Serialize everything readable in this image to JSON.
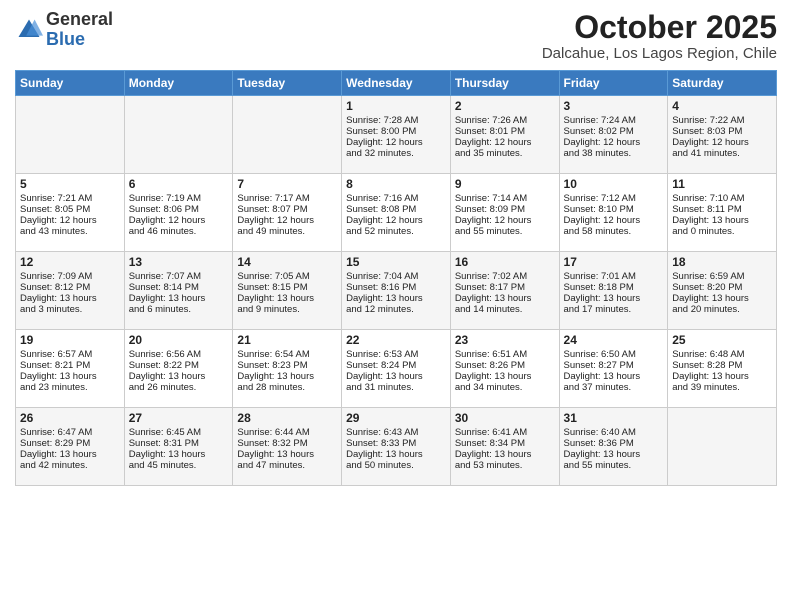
{
  "logo": {
    "general": "General",
    "blue": "Blue"
  },
  "title": "October 2025",
  "subtitle": "Dalcahue, Los Lagos Region, Chile",
  "headers": [
    "Sunday",
    "Monday",
    "Tuesday",
    "Wednesday",
    "Thursday",
    "Friday",
    "Saturday"
  ],
  "rows": [
    [
      {
        "day": "",
        "lines": []
      },
      {
        "day": "",
        "lines": []
      },
      {
        "day": "",
        "lines": []
      },
      {
        "day": "1",
        "lines": [
          "Sunrise: 7:28 AM",
          "Sunset: 8:00 PM",
          "Daylight: 12 hours",
          "and 32 minutes."
        ]
      },
      {
        "day": "2",
        "lines": [
          "Sunrise: 7:26 AM",
          "Sunset: 8:01 PM",
          "Daylight: 12 hours",
          "and 35 minutes."
        ]
      },
      {
        "day": "3",
        "lines": [
          "Sunrise: 7:24 AM",
          "Sunset: 8:02 PM",
          "Daylight: 12 hours",
          "and 38 minutes."
        ]
      },
      {
        "day": "4",
        "lines": [
          "Sunrise: 7:22 AM",
          "Sunset: 8:03 PM",
          "Daylight: 12 hours",
          "and 41 minutes."
        ]
      }
    ],
    [
      {
        "day": "5",
        "lines": [
          "Sunrise: 7:21 AM",
          "Sunset: 8:05 PM",
          "Daylight: 12 hours",
          "and 43 minutes."
        ]
      },
      {
        "day": "6",
        "lines": [
          "Sunrise: 7:19 AM",
          "Sunset: 8:06 PM",
          "Daylight: 12 hours",
          "and 46 minutes."
        ]
      },
      {
        "day": "7",
        "lines": [
          "Sunrise: 7:17 AM",
          "Sunset: 8:07 PM",
          "Daylight: 12 hours",
          "and 49 minutes."
        ]
      },
      {
        "day": "8",
        "lines": [
          "Sunrise: 7:16 AM",
          "Sunset: 8:08 PM",
          "Daylight: 12 hours",
          "and 52 minutes."
        ]
      },
      {
        "day": "9",
        "lines": [
          "Sunrise: 7:14 AM",
          "Sunset: 8:09 PM",
          "Daylight: 12 hours",
          "and 55 minutes."
        ]
      },
      {
        "day": "10",
        "lines": [
          "Sunrise: 7:12 AM",
          "Sunset: 8:10 PM",
          "Daylight: 12 hours",
          "and 58 minutes."
        ]
      },
      {
        "day": "11",
        "lines": [
          "Sunrise: 7:10 AM",
          "Sunset: 8:11 PM",
          "Daylight: 13 hours",
          "and 0 minutes."
        ]
      }
    ],
    [
      {
        "day": "12",
        "lines": [
          "Sunrise: 7:09 AM",
          "Sunset: 8:12 PM",
          "Daylight: 13 hours",
          "and 3 minutes."
        ]
      },
      {
        "day": "13",
        "lines": [
          "Sunrise: 7:07 AM",
          "Sunset: 8:14 PM",
          "Daylight: 13 hours",
          "and 6 minutes."
        ]
      },
      {
        "day": "14",
        "lines": [
          "Sunrise: 7:05 AM",
          "Sunset: 8:15 PM",
          "Daylight: 13 hours",
          "and 9 minutes."
        ]
      },
      {
        "day": "15",
        "lines": [
          "Sunrise: 7:04 AM",
          "Sunset: 8:16 PM",
          "Daylight: 13 hours",
          "and 12 minutes."
        ]
      },
      {
        "day": "16",
        "lines": [
          "Sunrise: 7:02 AM",
          "Sunset: 8:17 PM",
          "Daylight: 13 hours",
          "and 14 minutes."
        ]
      },
      {
        "day": "17",
        "lines": [
          "Sunrise: 7:01 AM",
          "Sunset: 8:18 PM",
          "Daylight: 13 hours",
          "and 17 minutes."
        ]
      },
      {
        "day": "18",
        "lines": [
          "Sunrise: 6:59 AM",
          "Sunset: 8:20 PM",
          "Daylight: 13 hours",
          "and 20 minutes."
        ]
      }
    ],
    [
      {
        "day": "19",
        "lines": [
          "Sunrise: 6:57 AM",
          "Sunset: 8:21 PM",
          "Daylight: 13 hours",
          "and 23 minutes."
        ]
      },
      {
        "day": "20",
        "lines": [
          "Sunrise: 6:56 AM",
          "Sunset: 8:22 PM",
          "Daylight: 13 hours",
          "and 26 minutes."
        ]
      },
      {
        "day": "21",
        "lines": [
          "Sunrise: 6:54 AM",
          "Sunset: 8:23 PM",
          "Daylight: 13 hours",
          "and 28 minutes."
        ]
      },
      {
        "day": "22",
        "lines": [
          "Sunrise: 6:53 AM",
          "Sunset: 8:24 PM",
          "Daylight: 13 hours",
          "and 31 minutes."
        ]
      },
      {
        "day": "23",
        "lines": [
          "Sunrise: 6:51 AM",
          "Sunset: 8:26 PM",
          "Daylight: 13 hours",
          "and 34 minutes."
        ]
      },
      {
        "day": "24",
        "lines": [
          "Sunrise: 6:50 AM",
          "Sunset: 8:27 PM",
          "Daylight: 13 hours",
          "and 37 minutes."
        ]
      },
      {
        "day": "25",
        "lines": [
          "Sunrise: 6:48 AM",
          "Sunset: 8:28 PM",
          "Daylight: 13 hours",
          "and 39 minutes."
        ]
      }
    ],
    [
      {
        "day": "26",
        "lines": [
          "Sunrise: 6:47 AM",
          "Sunset: 8:29 PM",
          "Daylight: 13 hours",
          "and 42 minutes."
        ]
      },
      {
        "day": "27",
        "lines": [
          "Sunrise: 6:45 AM",
          "Sunset: 8:31 PM",
          "Daylight: 13 hours",
          "and 45 minutes."
        ]
      },
      {
        "day": "28",
        "lines": [
          "Sunrise: 6:44 AM",
          "Sunset: 8:32 PM",
          "Daylight: 13 hours",
          "and 47 minutes."
        ]
      },
      {
        "day": "29",
        "lines": [
          "Sunrise: 6:43 AM",
          "Sunset: 8:33 PM",
          "Daylight: 13 hours",
          "and 50 minutes."
        ]
      },
      {
        "day": "30",
        "lines": [
          "Sunrise: 6:41 AM",
          "Sunset: 8:34 PM",
          "Daylight: 13 hours",
          "and 53 minutes."
        ]
      },
      {
        "day": "31",
        "lines": [
          "Sunrise: 6:40 AM",
          "Sunset: 8:36 PM",
          "Daylight: 13 hours",
          "and 55 minutes."
        ]
      },
      {
        "day": "",
        "lines": []
      }
    ]
  ]
}
